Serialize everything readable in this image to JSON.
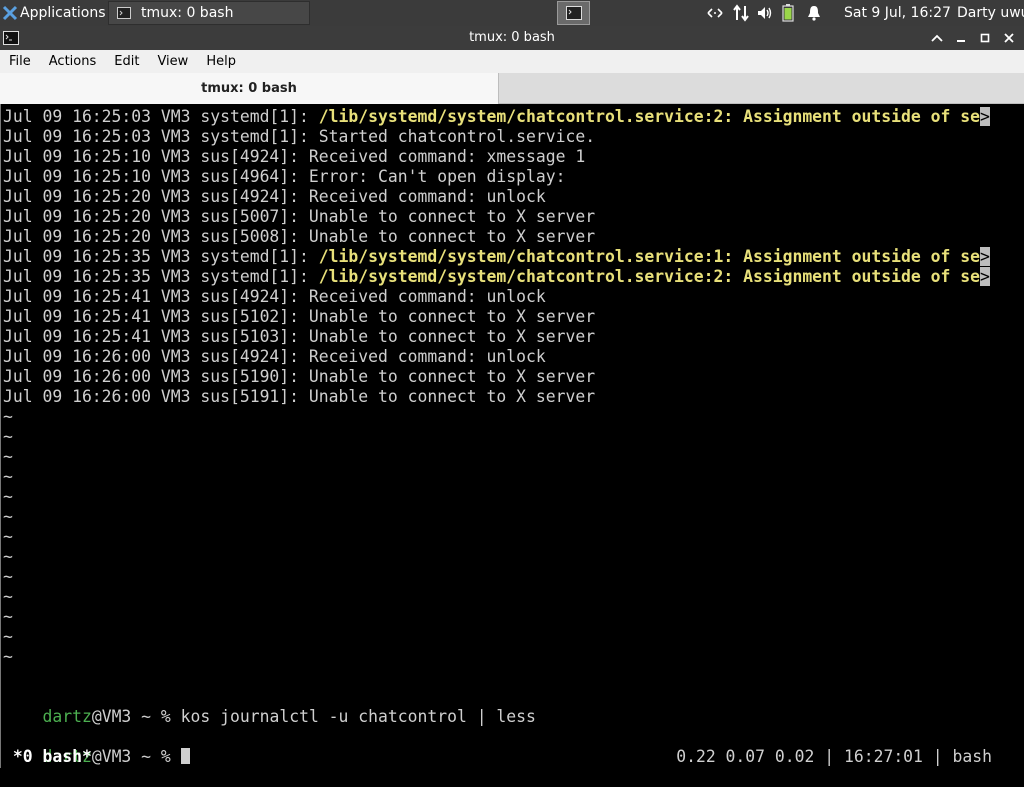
{
  "panel": {
    "apps_label": "Applications",
    "task_label": "tmux: 0 bash",
    "clock": "Sat  9 Jul, 16:27",
    "user": "Darty uwu",
    "tray_icons": [
      "network-icon",
      "transfer-icon",
      "volume-icon",
      "battery-icon",
      "bell-icon"
    ]
  },
  "window": {
    "title": "tmux: 0 bash"
  },
  "menubar": {
    "items": [
      "File",
      "Actions",
      "Edit",
      "View",
      "Help"
    ]
  },
  "tabs": [
    {
      "label": "tmux: 0 bash",
      "active": true
    }
  ],
  "terminal": {
    "log": [
      {
        "prefix": "Jul 09 16:25:03 VM3 systemd[1]: ",
        "msg": "/lib/systemd/system/chatcontrol.service:2: Assignment outside of se",
        "highlight": true,
        "truncated": true
      },
      {
        "prefix": "Jul 09 16:25:03 VM3 systemd[1]: ",
        "msg": "Started chatcontrol.service.",
        "highlight": false
      },
      {
        "prefix": "Jul 09 16:25:10 VM3 sus[4924]: ",
        "msg": "Received command: xmessage 1",
        "highlight": false
      },
      {
        "prefix": "Jul 09 16:25:10 VM3 sus[4964]: ",
        "msg": "Error: Can't open display:",
        "highlight": false
      },
      {
        "prefix": "Jul 09 16:25:20 VM3 sus[4924]: ",
        "msg": "Received command: unlock",
        "highlight": false
      },
      {
        "prefix": "Jul 09 16:25:20 VM3 sus[5007]: ",
        "msg": "Unable to connect to X server",
        "highlight": false
      },
      {
        "prefix": "Jul 09 16:25:20 VM3 sus[5008]: ",
        "msg": "Unable to connect to X server",
        "highlight": false
      },
      {
        "prefix": "Jul 09 16:25:35 VM3 systemd[1]: ",
        "msg": "/lib/systemd/system/chatcontrol.service:1: Assignment outside of se",
        "highlight": true,
        "truncated": true
      },
      {
        "prefix": "Jul 09 16:25:35 VM3 systemd[1]: ",
        "msg": "/lib/systemd/system/chatcontrol.service:2: Assignment outside of se",
        "highlight": true,
        "truncated": true
      },
      {
        "prefix": "Jul 09 16:25:41 VM3 sus[4924]: ",
        "msg": "Received command: unlock",
        "highlight": false
      },
      {
        "prefix": "Jul 09 16:25:41 VM3 sus[5102]: ",
        "msg": "Unable to connect to X server",
        "highlight": false
      },
      {
        "prefix": "Jul 09 16:25:41 VM3 sus[5103]: ",
        "msg": "Unable to connect to X server",
        "highlight": false
      },
      {
        "prefix": "Jul 09 16:26:00 VM3 sus[4924]: ",
        "msg": "Received command: unlock",
        "highlight": false
      },
      {
        "prefix": "Jul 09 16:26:00 VM3 sus[5190]: ",
        "msg": "Unable to connect to X server",
        "highlight": false
      },
      {
        "prefix": "Jul 09 16:26:00 VM3 sus[5191]: ",
        "msg": "Unable to connect to X server",
        "highlight": false
      }
    ],
    "truncation_marker": ">",
    "tilde": "~",
    "tilde_count": 13,
    "prompt_user": "dartz",
    "prompt_host": "@VM3",
    "prompt_suffix": " ~ % ",
    "command_history": "kos journalctl -u chatcontrol | less",
    "status_left": " *0 bash*",
    "status_right": "0.22 0.07 0.02 | 16:27:01 | bash"
  }
}
